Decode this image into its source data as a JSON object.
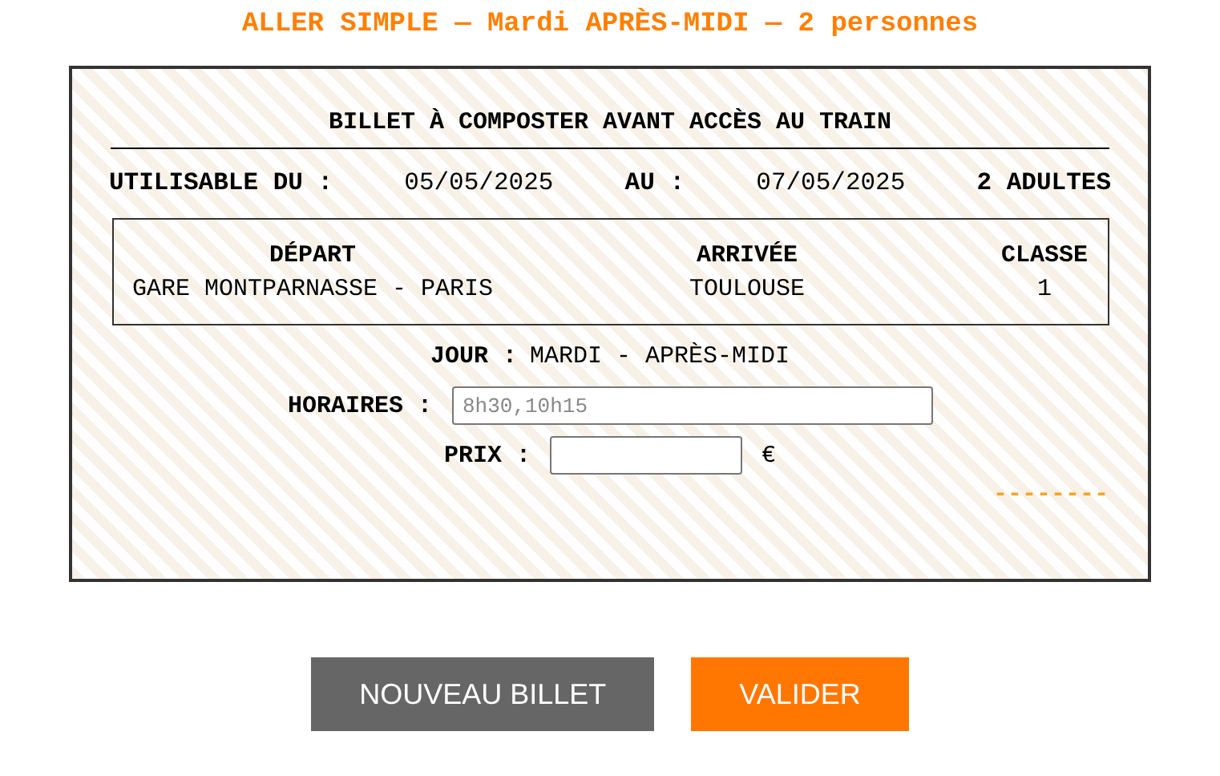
{
  "header": "ALLER SIMPLE — Mardi APRÈS-MIDI — 2 personnes",
  "ticket": {
    "title": "BILLET À COMPOSTER AVANT ACCÈS AU TRAIN",
    "validity": {
      "from_label": "UTILISABLE DU :",
      "from": "05/05/2025",
      "to_label": "AU :",
      "to": "07/05/2025",
      "passengers": "2 ADULTES"
    },
    "route": {
      "columns": [
        {
          "heading": "DÉPART",
          "value": "GARE MONTPARNASSE - PARIS"
        },
        {
          "heading": "ARRIVÉE",
          "value": "TOULOUSE"
        },
        {
          "heading": "CLASSE",
          "value": "1"
        }
      ]
    },
    "day": {
      "label": "JOUR :",
      "value": "MARDI - APRÈS-MIDI"
    },
    "schedule": {
      "label": "HORAIRES :",
      "placeholder": "8h30,10h15"
    },
    "price": {
      "label": "PRIX :",
      "currency": "€"
    },
    "stamp": "--------"
  },
  "buttons": [
    {
      "label": "NOUVEAU BILLET",
      "kind": "secondary"
    },
    {
      "label": "VALIDER",
      "kind": "primary"
    }
  ]
}
